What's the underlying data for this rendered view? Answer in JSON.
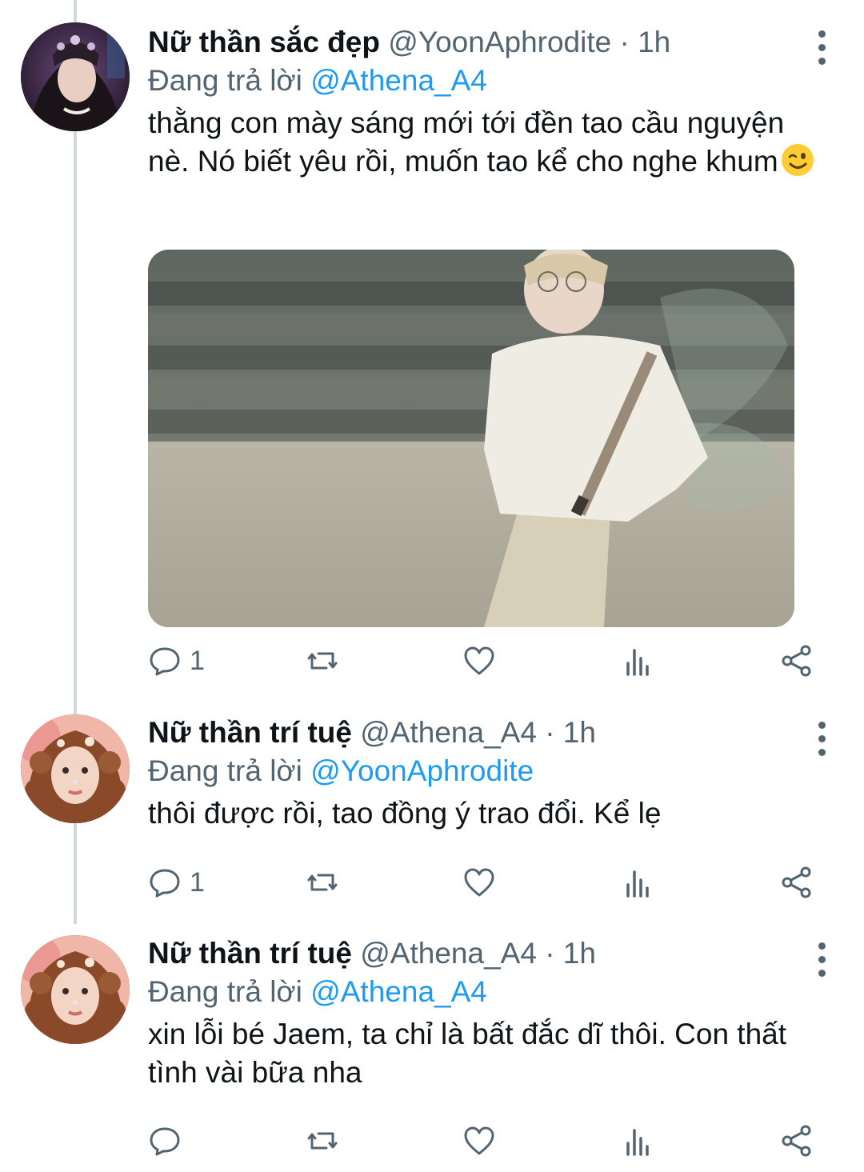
{
  "tweets": [
    {
      "display_name": "Nữ thần sắc đẹp",
      "handle": "@YoonAphrodite",
      "separator": "·",
      "time": "1h",
      "replying_prefix": "Đang trả lời",
      "replying_to": "@Athena_A4",
      "text": "thằng con mày sáng mới tới đền tao cầu nguyện nè. Nó biết yêu rồi, muốn tao kể cho nghe khum",
      "emoji": "winking-face-emoji",
      "has_media": true,
      "reply_count": "1",
      "avatar": "avatar-woman-dark-headpiece"
    },
    {
      "display_name": "Nữ thần trí tuệ",
      "handle": "@Athena_A4",
      "separator": "·",
      "time": "1h",
      "replying_prefix": "Đang trả lời",
      "replying_to": "@YoonAphrodite",
      "text": "thôi được rồi, tao đồng ý trao đổi. Kể lẹ",
      "reply_count": "1",
      "avatar": "avatar-woman-curly-hair"
    },
    {
      "display_name": "Nữ thần trí tuệ",
      "handle": "@Athena_A4",
      "separator": "·",
      "time": "1h",
      "replying_prefix": "Đang trả lời",
      "replying_to": "@Athena_A4",
      "text": "xin lỗi bé Jaem, ta chỉ là bất đắc dĩ thôi. Con thất tình vài bữa nha",
      "reply_count": "",
      "avatar": "avatar-woman-curly-hair"
    }
  ],
  "icons": {
    "reply": "reply-icon",
    "retweet": "retweet-icon",
    "like": "heart-icon",
    "analytics": "analytics-icon",
    "share": "share-icon",
    "more": "more-vertical-icon"
  },
  "colors": {
    "link": "#1d9bf0",
    "secondary_text": "#536471",
    "primary_text": "#0f1419",
    "thread_line": "#cfd9de"
  }
}
